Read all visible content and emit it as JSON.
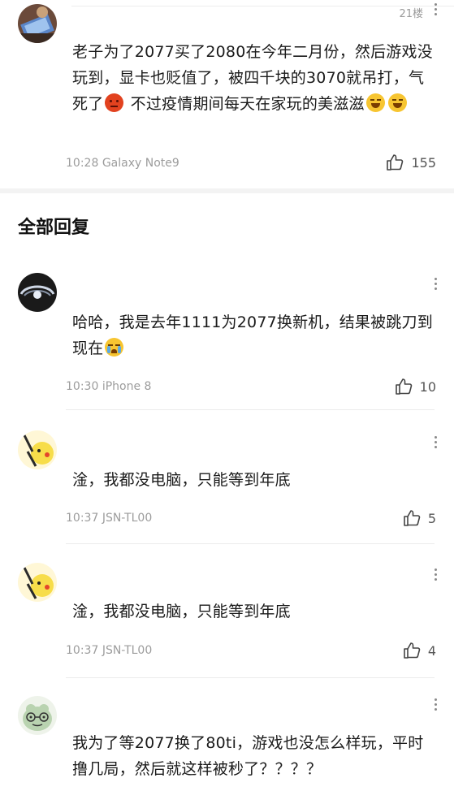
{
  "main_post": {
    "floor": "21楼",
    "text_a": "老子为了2077买了2080在今年二月份，然后游戏没玩到，显卡也贬值了，被四千块的3070就吊打，气死了",
    "text_b": " 不过疫情期间每天在家玩的美滋滋",
    "time": "10:28",
    "device": "Galaxy Note9",
    "likes": "155"
  },
  "section_title": "全部回复",
  "replies": [
    {
      "text": "哈哈，我是去年1111为2077换新机，结果被跳刀到现在",
      "time": "10:30",
      "device": "iPhone 8",
      "likes": "10"
    },
    {
      "text": "淦，我都没电脑，只能等到年底",
      "time": "10:37",
      "device": "JSN-TL00",
      "likes": "5"
    },
    {
      "text": "淦，我都没电脑，只能等到年底",
      "time": "10:37",
      "device": "JSN-TL00",
      "likes": "4"
    },
    {
      "text": "我为了等2077换了80ti，游戏也没怎么样玩，平时撸几局，然后就这样被秒了？？？？"
    }
  ],
  "icons": {
    "like": "thumbs-up-icon",
    "more": "more-vertical-icon",
    "emoji_angry": "angry-face-emoji",
    "emoji_laugh": "laughing-face-emoji",
    "emoji_cry": "crying-face-emoji"
  },
  "colors": {
    "text": "#1a1a1a",
    "meta": "#9c9c9c",
    "divider": "#f3f3f3"
  }
}
